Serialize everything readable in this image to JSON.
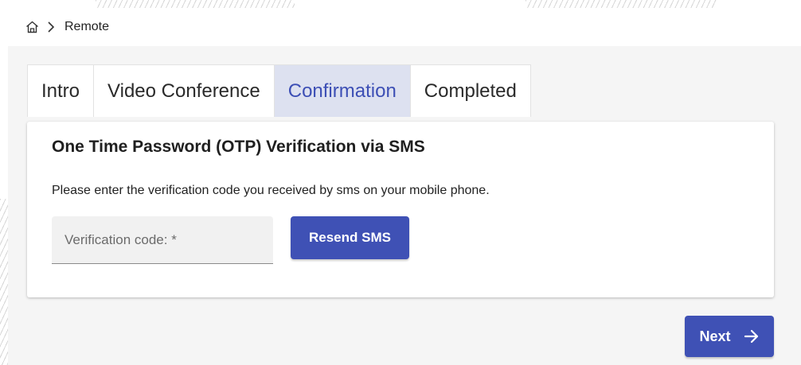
{
  "breadcrumb": {
    "home_icon": "home-icon",
    "separator_icon": "chevron-right-icon",
    "current": "Remote"
  },
  "tabs": [
    {
      "label": "Intro",
      "active": false
    },
    {
      "label": "Video Conference",
      "active": false
    },
    {
      "label": "Confirmation",
      "active": true
    },
    {
      "label": "Completed",
      "active": false
    }
  ],
  "card": {
    "title": "One Time Password (OTP) Verification via SMS",
    "description": "Please enter the verification code you received by sms on your mobile phone.",
    "otp_input": {
      "placeholder": "Verification code: *",
      "value": ""
    },
    "resend_label": "Resend SMS"
  },
  "footer": {
    "next_label": "Next",
    "next_icon": "arrow-right-icon"
  },
  "colors": {
    "primary": "#3f51b5",
    "active_tab_bg": "#dde1f0",
    "active_tab_text": "#3d4fb5",
    "content_bg": "#f5f5f5"
  }
}
